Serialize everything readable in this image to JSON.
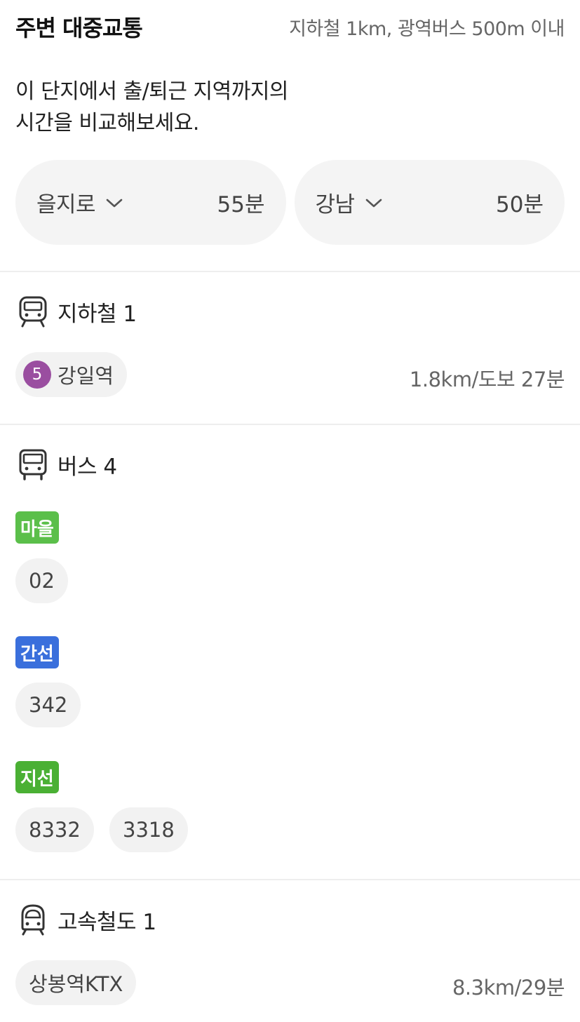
{
  "header": {
    "title": "주변 대중교통",
    "note": "지하철 1km, 광역버스 500m 이내"
  },
  "description": {
    "line1": "이 단지에서 출/퇴근 지역까지의",
    "line2": "시간을 비교해보세요."
  },
  "commute": [
    {
      "destination": "을지로",
      "time": "55분",
      "icon": "chevron-down-icon"
    },
    {
      "destination": "강남",
      "time": "50분",
      "icon": "chevron-down-icon"
    }
  ],
  "subway": {
    "icon": "subway-icon",
    "title": "지하철 1",
    "station": {
      "line_number": "5",
      "line_color": "#9a4ea0",
      "name": "강일역"
    },
    "distance": "1.8km/도보 27분"
  },
  "bus": {
    "icon": "bus-icon",
    "title": "버스 4",
    "groups": [
      {
        "type": "마을",
        "color": "#5bbf4a",
        "routes": [
          "02"
        ]
      },
      {
        "type": "간선",
        "color": "#3a6fdc",
        "routes": [
          "342"
        ]
      },
      {
        "type": "지선",
        "color": "#4ab034",
        "routes": [
          "8332",
          "3318"
        ]
      }
    ]
  },
  "rail": {
    "icon": "high-speed-train-icon",
    "title": "고속철도 1",
    "station": "상봉역KTX",
    "distance": "8.3km/29분"
  }
}
